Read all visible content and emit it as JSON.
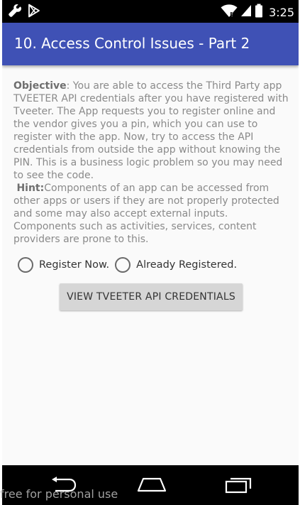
{
  "status_bar": {
    "time": "3:25",
    "icons": [
      "wrench-icon",
      "play-store-icon",
      "wifi-icon",
      "signal-icon",
      "battery-icon"
    ]
  },
  "app_bar": {
    "title": "10. Access Control Issues - Part 2",
    "color": "#3f51b5"
  },
  "content": {
    "objective_label": "Objective",
    "objective_text": ": You are able to access the Third Party app TVEETER API credentials after you have registered with Tveeter. The App requests you to register online and the vendor gives you a pin, which you can use to register with the app. Now, try to access the API credentials from outside the app without knowing the PIN. This is a business logic problem so you may need to see the code.",
    "hint_label": "Hint:",
    "hint_text": "Components of an app can be accessed from other apps or users if they are not properly protected and some may also accept external inputs. Components such as activities, services, content providers are prone to this."
  },
  "radios": [
    {
      "label": "Register Now.",
      "checked": false
    },
    {
      "label": "Already Registered.",
      "checked": false
    }
  ],
  "button": {
    "label": "VIEW TVEETER API CREDENTIALS"
  },
  "nav_bar": {
    "icons": [
      "back-icon",
      "home-icon",
      "recents-icon"
    ]
  },
  "watermark": "free for personal use"
}
